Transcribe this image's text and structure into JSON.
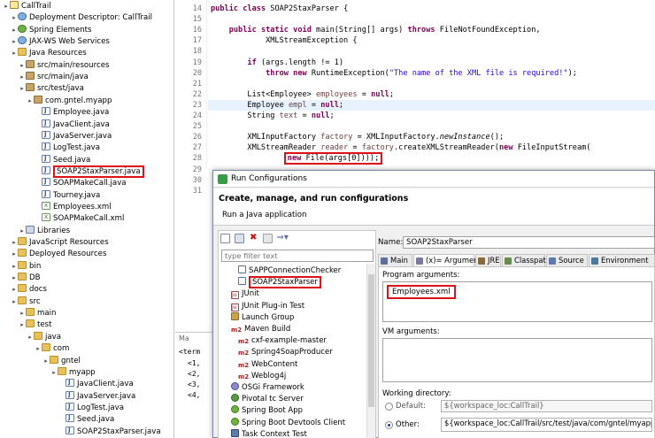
{
  "project_tree": {
    "items": [
      {
        "label": "CallTrail",
        "icon": "project-icon",
        "depth": 0
      },
      {
        "label": "Deployment Descriptor: CallTrail",
        "icon": "web-icon",
        "depth": 1
      },
      {
        "label": "Spring Elements",
        "icon": "spring-icon",
        "depth": 1
      },
      {
        "label": "JAX-WS Web Services",
        "icon": "web-icon",
        "depth": 1
      },
      {
        "label": "Java Resources",
        "icon": "folder-icon",
        "depth": 1
      },
      {
        "label": "src/main/resources",
        "icon": "package-folder-icon",
        "depth": 2
      },
      {
        "label": "src/main/java",
        "icon": "package-folder-icon",
        "depth": 2
      },
      {
        "label": "src/test/java",
        "icon": "package-folder-icon",
        "depth": 2
      },
      {
        "label": "com.gntel.myapp",
        "icon": "package-icon",
        "depth": 3
      },
      {
        "label": "Employee.java",
        "icon": "java-file-icon",
        "depth": 4
      },
      {
        "label": "JavaClient.java",
        "icon": "java-file-icon",
        "depth": 4
      },
      {
        "label": "JavaServer.java",
        "icon": "java-file-icon",
        "depth": 4
      },
      {
        "label": "LogTest.java",
        "icon": "java-file-icon",
        "depth": 4
      },
      {
        "label": "Seed.java",
        "icon": "java-file-icon",
        "depth": 4
      },
      {
        "label": "SOAP2StaxParser.java",
        "icon": "java-file-icon",
        "depth": 4,
        "highlighted": true
      },
      {
        "label": "SOAPMakeCall.java",
        "icon": "java-file-icon",
        "depth": 4
      },
      {
        "label": "Tourney.java",
        "icon": "java-file-icon",
        "depth": 4
      },
      {
        "label": "Employees.xml",
        "icon": "xml-file-icon",
        "depth": 4
      },
      {
        "label": "SOAPMakeCall.xml",
        "icon": "xml-file-icon",
        "depth": 4
      },
      {
        "label": "Libraries",
        "icon": "library-icon",
        "depth": 2
      },
      {
        "label": "JavaScript Resources",
        "icon": "folder-icon",
        "depth": 1
      },
      {
        "label": "Deployed Resources",
        "icon": "folder-icon",
        "depth": 1
      },
      {
        "label": "bin",
        "icon": "folder-icon",
        "depth": 1
      },
      {
        "label": "DB",
        "icon": "folder-icon",
        "depth": 1
      },
      {
        "label": "docs",
        "icon": "folder-icon",
        "depth": 1
      },
      {
        "label": "src",
        "icon": "folder-icon",
        "depth": 1
      },
      {
        "label": "main",
        "icon": "folder-icon",
        "depth": 2
      },
      {
        "label": "test",
        "icon": "folder-icon",
        "depth": 2
      },
      {
        "label": "java",
        "icon": "folder-icon",
        "depth": 3
      },
      {
        "label": "com",
        "icon": "folder-icon",
        "depth": 4
      },
      {
        "label": "gntel",
        "icon": "folder-icon",
        "depth": 5
      },
      {
        "label": "myapp",
        "icon": "folder-icon",
        "depth": 6
      },
      {
        "label": "JavaClient.java",
        "icon": "java-file-icon",
        "depth": 7
      },
      {
        "label": "JavaServer.java",
        "icon": "java-file-icon",
        "depth": 7
      },
      {
        "label": "LogTest.java",
        "icon": "java-file-icon",
        "depth": 7
      },
      {
        "label": "Seed.java",
        "icon": "java-file-icon",
        "depth": 7
      },
      {
        "label": "SOAP2StaxParser.java",
        "icon": "java-file-icon",
        "depth": 7
      }
    ]
  },
  "editor": {
    "lines": [
      {
        "num": "14",
        "text": "public class SOAP2StaxParser {"
      },
      {
        "num": "15",
        "text": ""
      },
      {
        "num": "16",
        "text": "    public static void main(String[] args) throws FileNotFoundException,"
      },
      {
        "num": "17",
        "text": "            XMLStreamException {"
      },
      {
        "num": "18",
        "text": ""
      },
      {
        "num": "19",
        "text": "        if (args.length != 1)"
      },
      {
        "num": "20",
        "text": "            throw new RuntimeException(\"The name of the XML file is required!\");"
      },
      {
        "num": "21",
        "text": ""
      },
      {
        "num": "22",
        "text": "        List<Employee> employees = null;"
      },
      {
        "num": "23",
        "text": "        Employee empl = null;"
      },
      {
        "num": "24",
        "text": "        String text = null;"
      },
      {
        "num": "25",
        "text": ""
      },
      {
        "num": "26",
        "text": "        XMLInputFactory factory = XMLInputFactory.newInstance();"
      },
      {
        "num": "27",
        "text": "        XMLStreamReader reader = factory.createXMLStreamReader(new FileInputStream("
      },
      {
        "num": "28",
        "text": "                new File(args[0])));"
      },
      {
        "num": "29",
        "text": ""
      },
      {
        "num": "30",
        "text": ""
      },
      {
        "num": "31",
        "text": ""
      }
    ]
  },
  "console": {
    "tab_label": "Ma",
    "term_label": "<term",
    "lines": [
      "<1, ",
      "<2, ",
      "<3, ",
      "<4, "
    ]
  },
  "dialog": {
    "title": "Run Configurations",
    "heading": "Create, manage, and run configurations",
    "subheading": "Run a Java application",
    "filter_placeholder": "type filter text",
    "config_items": [
      {
        "label": "SAPPConnectionChecker",
        "icon": "java-app-icon",
        "depth": 2
      },
      {
        "label": "SOAP2StaxParser",
        "icon": "java-app-icon",
        "depth": 2,
        "selected": true
      },
      {
        "label": "JUnit",
        "icon": "junit-icon",
        "depth": 1
      },
      {
        "label": "JUnit Plug-in Test",
        "icon": "junit-plugin-icon",
        "depth": 1
      },
      {
        "label": "Launch Group",
        "icon": "launch-group-icon",
        "depth": 1
      },
      {
        "label": "Maven Build",
        "icon": "maven-icon",
        "depth": 1
      },
      {
        "label": "cxf-example-master",
        "icon": "maven-icon",
        "depth": 2
      },
      {
        "label": "Spring4SoapProducer",
        "icon": "maven-icon",
        "depth": 2
      },
      {
        "label": "WebContent",
        "icon": "maven-icon",
        "depth": 2
      },
      {
        "label": "Weblog4j",
        "icon": "maven-icon",
        "depth": 2
      },
      {
        "label": "OSGi Framework",
        "icon": "osgi-icon",
        "depth": 1
      },
      {
        "label": "Pivotal tc Server",
        "icon": "tc-server-icon",
        "depth": 1
      },
      {
        "label": "Spring Boot App",
        "icon": "spring-boot-icon",
        "depth": 1
      },
      {
        "label": "Spring Boot Devtools Client",
        "icon": "spring-boot-icon",
        "depth": 1
      },
      {
        "label": "Task Context Test",
        "icon": "task-icon",
        "depth": 1
      }
    ],
    "name_label": "Name:",
    "name_value": "SOAP2StaxParser",
    "tabs": [
      {
        "label": "Main",
        "icon": "main-tab-icon"
      },
      {
        "label": "(x)= Arguments",
        "icon": "arguments-tab-icon",
        "active": true
      },
      {
        "label": "JRE",
        "icon": "jre-tab-icon"
      },
      {
        "label": "Classpath",
        "icon": "classpath-tab-icon"
      },
      {
        "label": "Source",
        "icon": "source-tab-icon"
      },
      {
        "label": "Environment",
        "icon": "environment-tab-icon"
      }
    ],
    "program_args_label": "Program arguments:",
    "program_args_value": "Employees.xml",
    "vm_args_label": "VM arguments:",
    "vm_args_value": "",
    "working_dir_label": "Working directory:",
    "default_label": "Default:",
    "default_value": "${workspace_loc:CallTrail}",
    "other_label": "Other:",
    "other_value": "${workspace_loc:CallTrail/src/test/java/com/gntel/myapp}"
  },
  "colors": {
    "highlight_box": "#e0101a",
    "keyword": "#7f0055",
    "string": "#2a00ff",
    "local_var": "#6a3e3e"
  }
}
